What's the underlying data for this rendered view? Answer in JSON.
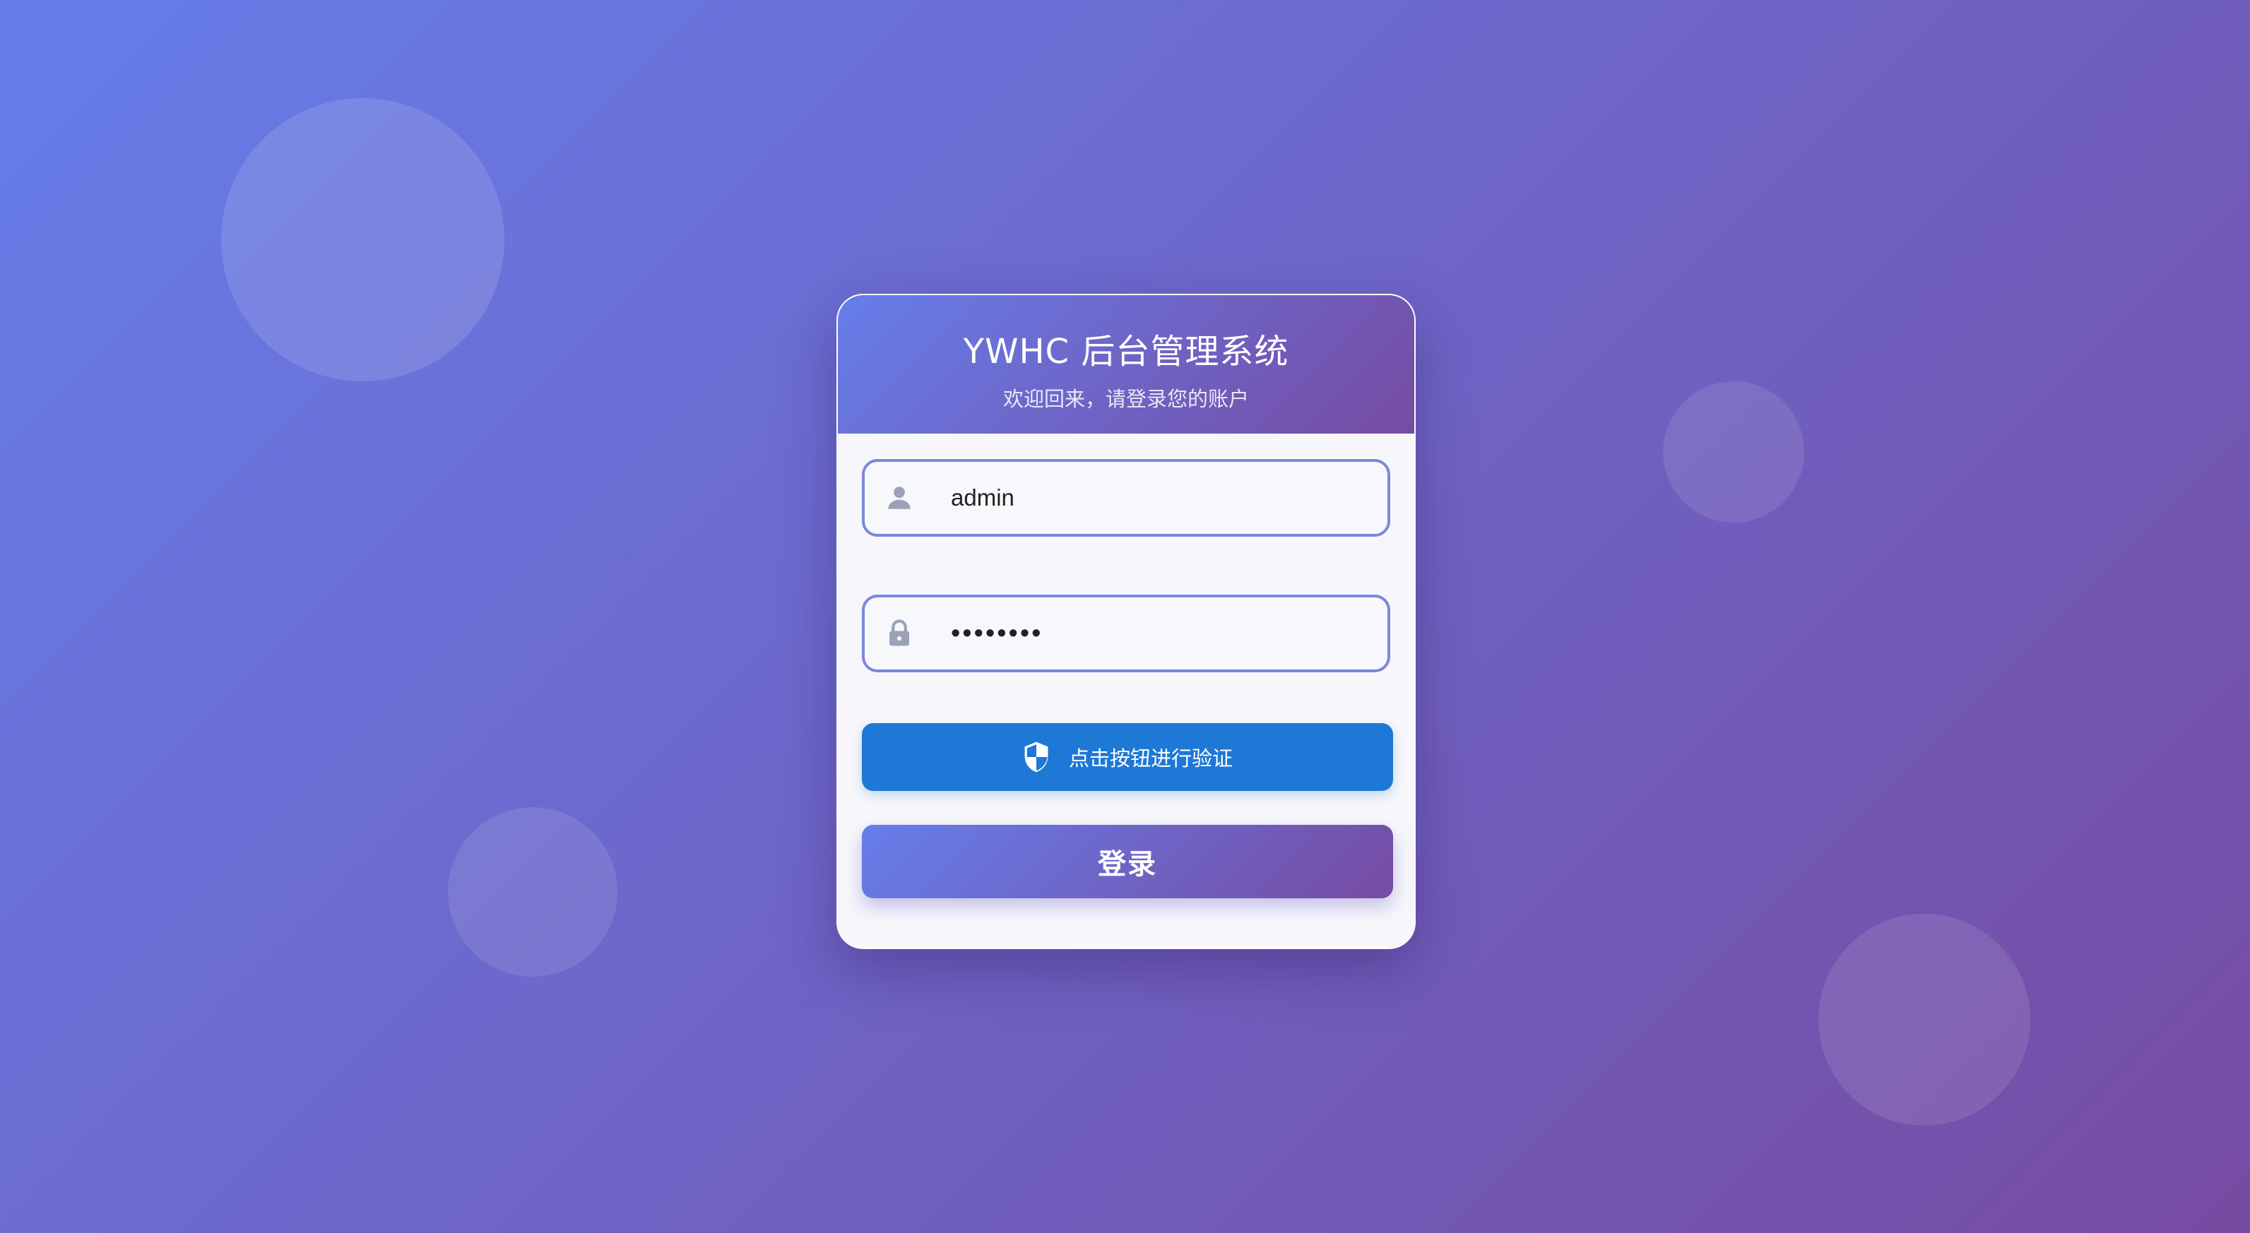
{
  "header": {
    "title": "YWHC 后台管理系统",
    "subtitle": "欢迎回来，请登录您的账户"
  },
  "form": {
    "username": {
      "value": "admin",
      "icon": "user-icon"
    },
    "password": {
      "value": "••••••••",
      "icon": "lock-icon"
    },
    "verify_button": {
      "label": "点击按钮进行验证",
      "icon": "shield-icon"
    },
    "login_button": {
      "label": "登录"
    }
  },
  "colors": {
    "gradient_start": "#667eea",
    "gradient_end": "#764ba2",
    "verify_button": "#1e78d6",
    "input_border": "#7b87dc"
  }
}
